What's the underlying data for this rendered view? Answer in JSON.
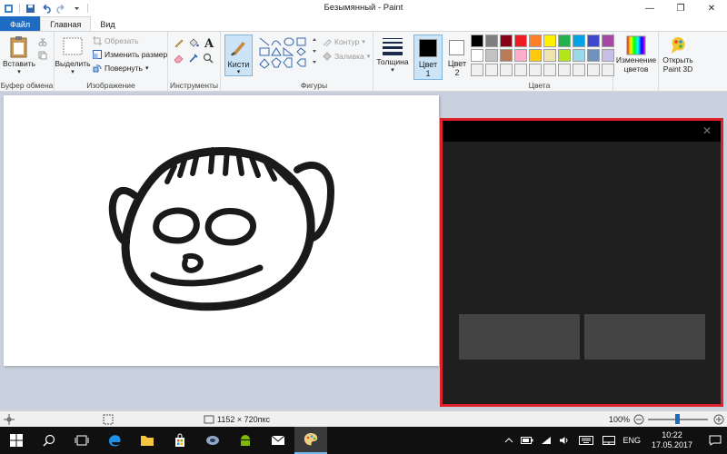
{
  "window": {
    "title": "Безымянный - Paint",
    "controls": {
      "minimize": "—",
      "maximize": "❐",
      "close": "✕"
    }
  },
  "tabs": {
    "file": "Файл",
    "home": "Главная",
    "view": "Вид"
  },
  "ribbon": {
    "clipboard": {
      "paste": "Вставить",
      "label": "Буфер обмена"
    },
    "image": {
      "select": "Выделить",
      "crop": "Обрезать",
      "resize": "Изменить размер",
      "rotate": "Повернуть",
      "label": "Изображение"
    },
    "tools": {
      "label": "Инструменты"
    },
    "brushes": {
      "label": "Кисти"
    },
    "shapes": {
      "outline": "Контур",
      "fill": "Заливка",
      "label": "Фигуры"
    },
    "size": {
      "label": "Толщина"
    },
    "color1": {
      "label": "Цвет",
      "num": "1",
      "value": "#000000"
    },
    "color2": {
      "label": "Цвет",
      "num": "2",
      "value": "#ffffff"
    },
    "colors": {
      "label": "Цвета",
      "palette_row1": [
        "#000000",
        "#7f7f7f",
        "#880015",
        "#ed1c24",
        "#ff7f27",
        "#fff200",
        "#22b14c",
        "#00a2e8",
        "#3f48cc",
        "#a349a4"
      ],
      "palette_row2": [
        "#ffffff",
        "#c3c3c3",
        "#b97a57",
        "#ffaec9",
        "#ffc90e",
        "#efe4b0",
        "#b5e61d",
        "#99d9ea",
        "#7092be",
        "#c8bfe7"
      ],
      "palette_row3": [
        "#f0f0f0",
        "#f0f0f0",
        "#f0f0f0",
        "#f0f0f0",
        "#f0f0f0",
        "#f0f0f0",
        "#f0f0f0",
        "#f0f0f0",
        "#f0f0f0",
        "#f0f0f0"
      ]
    },
    "edit_colors": {
      "line1": "Изменение",
      "line2": "цветов"
    },
    "paint3d": {
      "line1": "Открыть",
      "line2": "Paint 3D"
    }
  },
  "status": {
    "dimensions": "1152 × 720пкс",
    "zoom": "100%"
  },
  "taskbar": {
    "lang": "ENG",
    "time": "10:22",
    "date": "17.05.2017"
  }
}
